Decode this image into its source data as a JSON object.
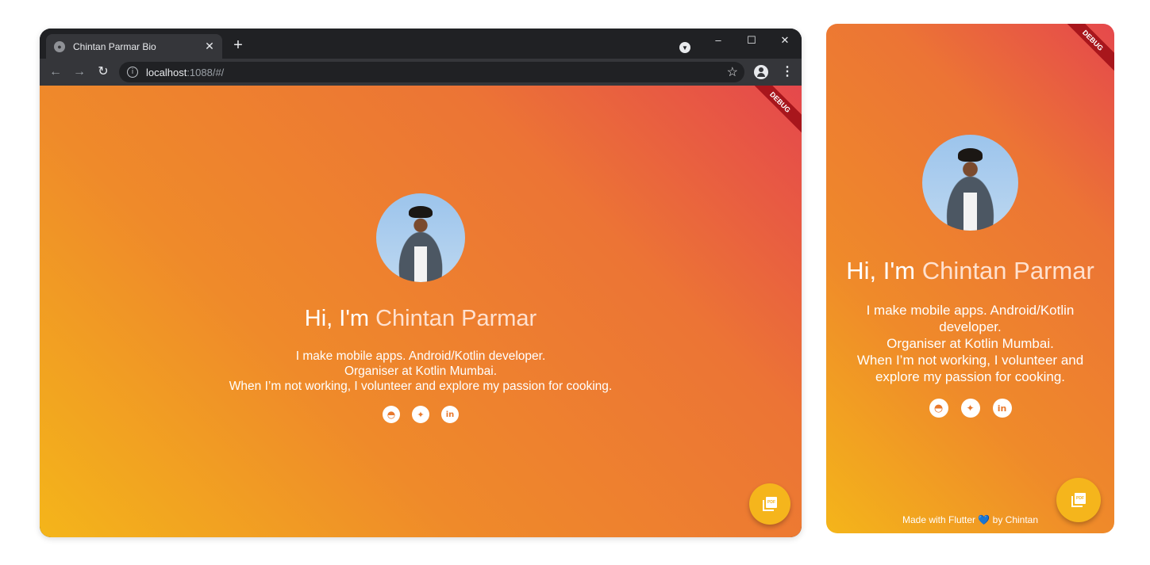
{
  "browser": {
    "tab_title": "Chintan Parmar Bio",
    "tab_close": "✕",
    "new_tab": "+",
    "url_host": "localhost",
    "url_rest": ":1088/#/",
    "info_icon": "i",
    "back_glyph": "←",
    "forward_glyph": "→",
    "reload_glyph": "↻",
    "star_glyph": "☆",
    "menu_glyph": "⋮",
    "profile_dd_glyph": "▼",
    "window_controls": {
      "minimize": "–",
      "maximize": "☐",
      "close": "✕"
    }
  },
  "profile": {
    "greeting": "Hi, I'm ",
    "name": "Chintan Parmar",
    "bio_line_1": "I make mobile apps. Android/Kotlin developer.",
    "bio_line_2": "Organiser at Kotlin Mumbai.",
    "bio_line_3": "When I’m not working, I volunteer and explore my passion for cooking.",
    "mobile_bio_1": "I make mobile apps. Android/Kotlin",
    "mobile_bio_2": "developer.",
    "mobile_bio_3": "Organiser at Kotlin Mumbai.",
    "mobile_bio_4": "When I’m not working, I volunteer and",
    "mobile_bio_5": "explore my passion for cooking.",
    "photo_alt": "profile-photo"
  },
  "socials": [
    {
      "icon": "github-icon",
      "glyph": "◓"
    },
    {
      "icon": "twitter-icon",
      "glyph": "✦"
    },
    {
      "icon": "linkedin-icon",
      "glyph": "in"
    }
  ],
  "debug_banner": "DEBUG",
  "fab": {
    "icon": "pdf-icon",
    "label": "PDF"
  },
  "footer": {
    "prefix": "Made with Flutter ",
    "heart": "💙",
    "suffix": " by Chintan"
  },
  "colors": {
    "gradient_top_right": "#e5484c",
    "gradient_bottom_left": "#f4b51a",
    "fab": "#f5b51c",
    "name_accent": "#ffe1cf"
  }
}
